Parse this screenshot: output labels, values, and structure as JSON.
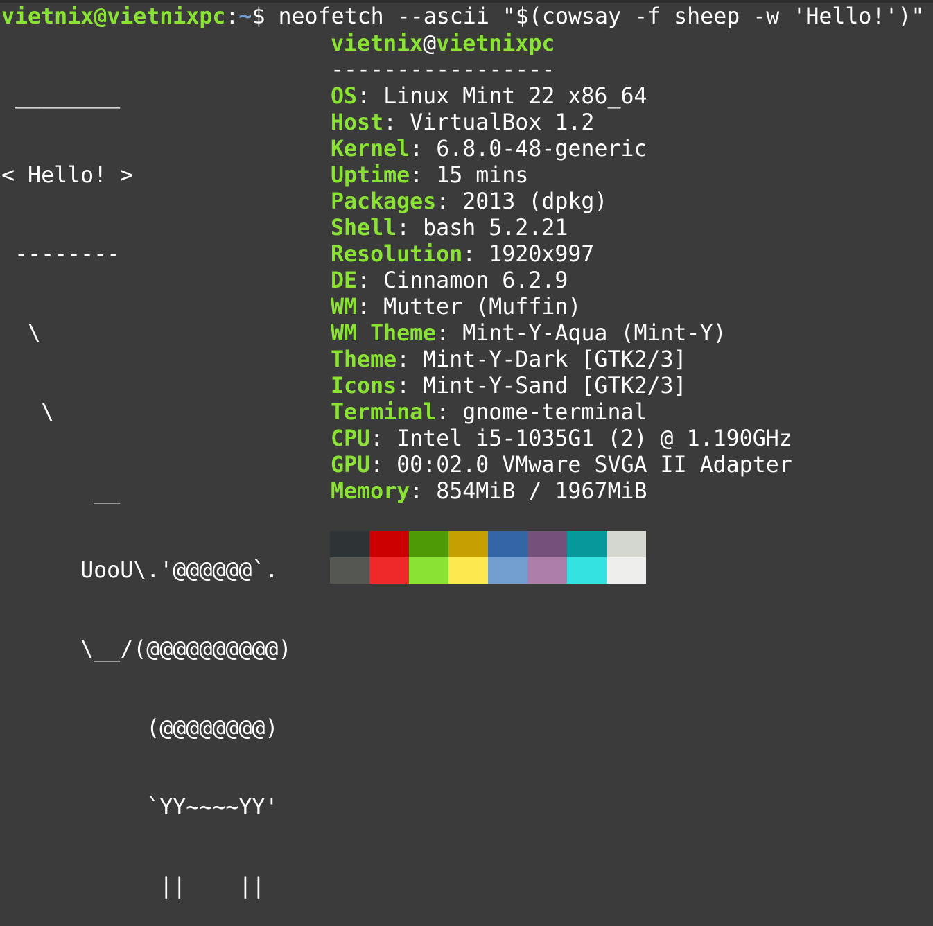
{
  "prompt": {
    "user": "vietnix",
    "at": "@",
    "host": "vietnixpc",
    "colon": ":",
    "path": "~",
    "symbol": "$ ",
    "command": "neofetch --ascii \"$(cowsay -f sheep -w 'Hello!')\""
  },
  "ascii_art": [
    " ________",
    "< Hello! >",
    " --------",
    "  \\",
    "   \\",
    "       __",
    "      UooU\\.'@@@@@@`.",
    "      \\__/(@@@@@@@@@@)",
    "           (@@@@@@@@)",
    "           `YY~~~~YY'",
    "            ||    ||"
  ],
  "info": {
    "user": "vietnix",
    "at": "@",
    "host": "vietnixpc",
    "separator": "-----------------",
    "rows": [
      {
        "key": "OS",
        "value": "Linux Mint 22 x86_64"
      },
      {
        "key": "Host",
        "value": "VirtualBox 1.2"
      },
      {
        "key": "Kernel",
        "value": "6.8.0-48-generic"
      },
      {
        "key": "Uptime",
        "value": "15 mins"
      },
      {
        "key": "Packages",
        "value": "2013 (dpkg)"
      },
      {
        "key": "Shell",
        "value": "bash 5.2.21"
      },
      {
        "key": "Resolution",
        "value": "1920x997"
      },
      {
        "key": "DE",
        "value": "Cinnamon 6.2.9"
      },
      {
        "key": "WM",
        "value": "Mutter (Muffin)"
      },
      {
        "key": "WM Theme",
        "value": "Mint-Y-Aqua (Mint-Y)"
      },
      {
        "key": "Theme",
        "value": "Mint-Y-Dark [GTK2/3]"
      },
      {
        "key": "Icons",
        "value": "Mint-Y-Sand [GTK2/3]"
      },
      {
        "key": "Terminal",
        "value": "gnome-terminal"
      },
      {
        "key": "CPU",
        "value": "Intel i5-1035G1 (2) @ 1.190GHz"
      },
      {
        "key": "GPU",
        "value": "00:02.0 VMware SVGA II Adapter"
      },
      {
        "key": "Memory",
        "value": "854MiB / 1967MiB"
      }
    ]
  },
  "palette": {
    "normal": [
      "#2e3436",
      "#cc0000",
      "#4e9a06",
      "#c4a000",
      "#3465a4",
      "#75507b",
      "#06989a",
      "#d3d7cf"
    ],
    "bright": [
      "#555753",
      "#ef2929",
      "#8ae234",
      "#fce94f",
      "#729fcf",
      "#ad7fa8",
      "#34e2e2",
      "#eeeeec"
    ]
  },
  "colors": {
    "background": "#3b3b3b",
    "accent_green": "#8ae234",
    "path_blue": "#729fcf",
    "text": "#ffffff"
  }
}
